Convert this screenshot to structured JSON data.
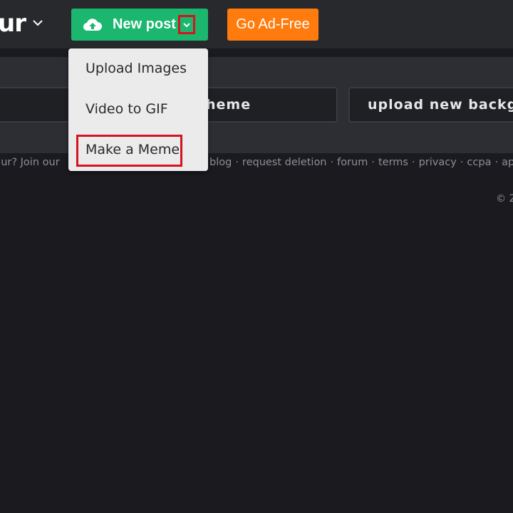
{
  "nav": {
    "logo": "ur",
    "new_post_label": "New post",
    "ad_free_label": "Go Ad-Free"
  },
  "menu": {
    "items": [
      {
        "label": "Upload Images"
      },
      {
        "label": "Video to GIF"
      },
      {
        "label": "Make a Meme"
      }
    ]
  },
  "meme": {
    "new_meme_label": "heme",
    "upload_background_label": "upload new backgr"
  },
  "footer": {
    "join_text": "gur? Join our",
    "links": [
      "blog",
      "request deletion",
      "forum",
      "terms",
      "privacy",
      "ccpa",
      "apps"
    ],
    "separator": "·",
    "copyright_fragment": "© 2"
  },
  "colors": {
    "nav_bg": "#27292d",
    "page_bg": "#1b1b1f",
    "new_post_green": "#1bb76e",
    "ad_free_orange": "#ff7b0d",
    "highlight_red": "#d4141f",
    "menu_bg": "#ebebeb"
  },
  "icons": [
    "cloud-upload-icon",
    "chevron-down-icon"
  ]
}
